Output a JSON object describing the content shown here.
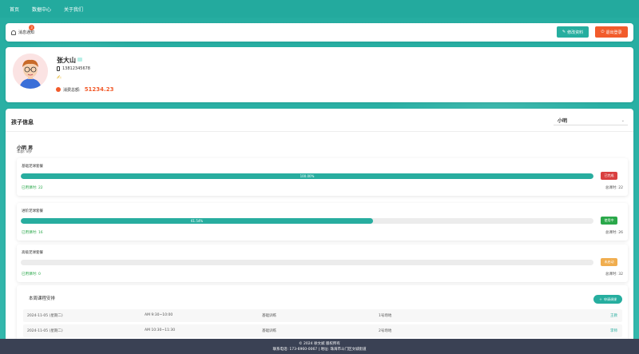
{
  "nav": {
    "items": [
      "首页",
      "数据中心",
      "关于我们"
    ]
  },
  "toolbar": {
    "notice_label": "消息通知",
    "notice_count": "3",
    "edit_label": "修改资料",
    "logout_label": "退出登录"
  },
  "profile": {
    "name": "张大山",
    "phone": "13812345678",
    "consume_label": "消费总额:",
    "consume_value": "51234.23"
  },
  "kids": {
    "title": "孩子信息",
    "selected": "小明",
    "child_name": "小明 男",
    "child_age": "年龄: 8岁"
  },
  "packages": [
    {
      "name": "基础足球套餐",
      "progress_label": "100.00%",
      "progress": 1.0,
      "status": "已完成",
      "status_color": "#d94040",
      "used": "已用课时: 22",
      "total": "总课时: 22"
    },
    {
      "name": "进阶足球套餐",
      "progress_label": "61.54%",
      "progress": 0.6154,
      "status": "使用中",
      "status_color": "#2aa84a",
      "used": "已用课时: 16",
      "total": "总课时: 26"
    },
    {
      "name": "高级足球套餐",
      "progress_label": "",
      "progress": 0,
      "status": "未启动",
      "status_color": "#f0ad4e",
      "used": "已用课时: 0",
      "total": "总课时: 32"
    }
  ],
  "schedule": {
    "title": "本周课程安排",
    "add_label": "申请调课",
    "rows": [
      {
        "date": "2024-11-05 (星期二)",
        "time": "AM 9:30~10:00",
        "type": "基础训练",
        "place": "1号场地",
        "coach": "王教"
      },
      {
        "date": "2024-11-05 (星期二)",
        "time": "AM 10:30~11:30",
        "type": "基础训练",
        "place": "2号场地",
        "coach": "李师"
      }
    ]
  },
  "footer": {
    "line1": "© 2024 徐文斌 版权所有",
    "line2": "联系电话: 173-6960-0067 | 地址: 珠海市斗门区文城街道"
  }
}
